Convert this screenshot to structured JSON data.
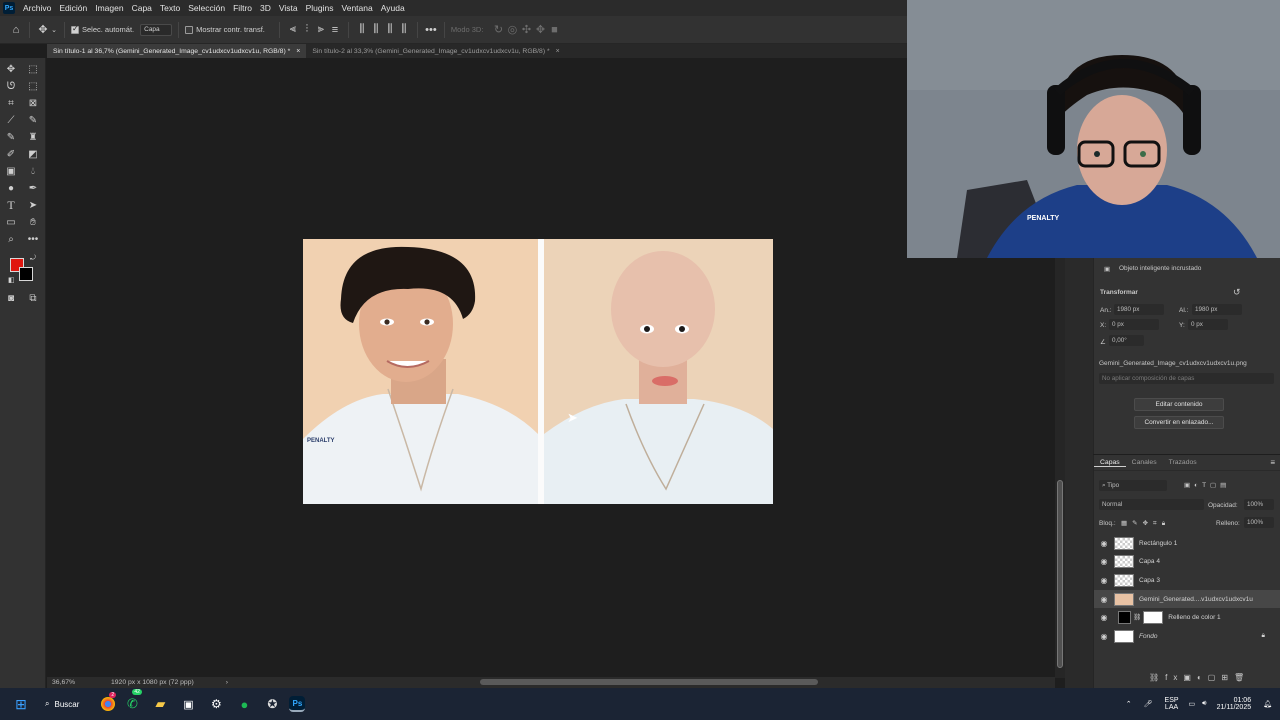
{
  "menubar": {
    "logo": "Ps",
    "items": [
      "Archivo",
      "Edición",
      "Imagen",
      "Capa",
      "Texto",
      "Selección",
      "Filtro",
      "3D",
      "Vista",
      "Plugins",
      "Ventana",
      "Ayuda"
    ]
  },
  "options": {
    "auto_select_label": "Selec. automát.",
    "auto_select_target": "Capa",
    "show_transform_label": "Mostrar contr. transf.",
    "mode_3d": "Modo 3D:"
  },
  "tabs": [
    {
      "label": "Sin título-1 al 36,7% (Gemini_Generated_Image_cv1udxcv1udxcv1u, RGB/8) *",
      "active": true
    },
    {
      "label": "Sin título-2 al 33,3% (Gemini_Generated_Image_cv1udxcv1udxcv1u, RGB/8) *",
      "active": false
    }
  ],
  "status": {
    "zoom": "36,67%",
    "doc_info": "1920 px x 1080 px (72 ppp)"
  },
  "properties": {
    "header": "Objeto inteligente incrustado",
    "section": "Transformar",
    "w_label": "An.:",
    "w_value": "1980 px",
    "h_label": "Al.:",
    "h_value": "1980 px",
    "x_label": "X:",
    "x_value": "0 px",
    "y_label": "Y:",
    "y_value": "0 px",
    "angle_value": "0,00°",
    "filename": "Gemini_Generated_Image_cv1udxcv1udxcv1u.png",
    "comp_placeholder": "No aplicar composición de capas",
    "edit_button": "Editar contenido",
    "convert_button": "Convertir en enlazado..."
  },
  "layers_panel": {
    "tabs": [
      "Capas",
      "Canales",
      "Trazados"
    ],
    "filter": "Tipo",
    "blend_mode": "Normal",
    "opacity_label": "Opacidad:",
    "opacity_value": "100%",
    "lock_label": "Bloq.:",
    "fill_label": "Relleno:",
    "fill_value": "100%",
    "layers": [
      {
        "name": "Rectángulo 1"
      },
      {
        "name": "Capa 4"
      },
      {
        "name": "Capa 3"
      },
      {
        "name": "Gemini_Generated....v1udxcv1udxcv1u",
        "selected": true
      },
      {
        "name": "Relleno de color 1"
      },
      {
        "name": "Fondo"
      }
    ]
  },
  "taskbar": {
    "search_label": "Buscar",
    "lang_top": "ESP",
    "lang_bottom": "LAA",
    "time": "01:06",
    "date": "21/11/2025",
    "badge_count": "2",
    "badge_count_2": "42"
  },
  "colors": {
    "foreground": "#e0160f",
    "background": "#000000",
    "accent": "#31a8ff"
  }
}
